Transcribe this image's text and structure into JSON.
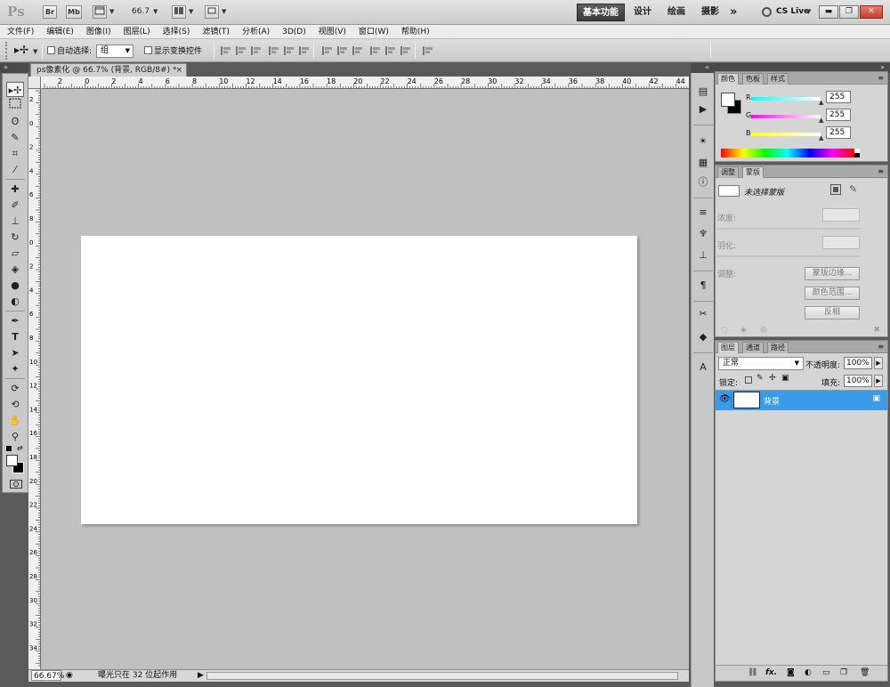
{
  "appbar": {
    "logo": "Ps",
    "br_label": "Br",
    "mb_label": "Mb",
    "zoom": "66.7",
    "workspaces": [
      "基本功能",
      "设计",
      "绘画",
      "摄影"
    ],
    "more": "»",
    "cslive": "CS Live"
  },
  "menu": [
    "文件(F)",
    "编辑(E)",
    "图像(I)",
    "图层(L)",
    "选择(S)",
    "滤镜(T)",
    "分析(A)",
    "3D(D)",
    "视图(V)",
    "窗口(W)",
    "帮助(H)"
  ],
  "options": {
    "auto_select_label": "自动选择:",
    "auto_select_value": "组",
    "show_transform_label": "显示变换控件"
  },
  "document": {
    "tab_title": "ps像素化 @ 66.7% (背景, RGB/8#) *",
    "close_glyph": "×",
    "ruler_top_labels": [
      "2",
      "0",
      "2",
      "4",
      "6",
      "8",
      "10",
      "12",
      "14",
      "16",
      "18",
      "20",
      "22",
      "24",
      "26",
      "28",
      "30",
      "32",
      "34",
      "36",
      "38",
      "40",
      "42",
      "44"
    ],
    "ruler_left_labels": [
      "2",
      "0",
      "2",
      "4",
      "6",
      "8",
      "0",
      "2",
      "4",
      "6",
      "8",
      "10",
      "12",
      "14",
      "16",
      "18",
      "20",
      "22",
      "24",
      "26",
      "28",
      "30",
      "32",
      "34"
    ]
  },
  "status": {
    "zoom": "66.67%",
    "text": "曝光只在 32 位起作用"
  },
  "color_panel": {
    "tabs": [
      "颜色",
      "色板",
      "样式"
    ],
    "r_label": "R",
    "g_label": "G",
    "b_label": "B",
    "r_value": "255",
    "g_value": "255",
    "b_value": "255"
  },
  "masks_panel": {
    "tabs": [
      "调整",
      "蒙版"
    ],
    "no_mask": "未选择蒙版",
    "density_label": "浓度:",
    "feather_label": "羽化:",
    "refine_label": "调整:",
    "mask_edge_btn": "蒙版边缘...",
    "color_range_btn": "颜色范围...",
    "invert_btn": "反相"
  },
  "layers_panel": {
    "tabs": [
      "图层",
      "通道",
      "路径"
    ],
    "blend_mode": "正常",
    "opacity_label": "不透明度:",
    "opacity_value": "100%",
    "lock_label": "锁定:",
    "fill_label": "填充:",
    "fill_value": "100%",
    "layer_name": "背景",
    "footer_fx": "fx."
  },
  "colors": {
    "selected_layer": "#3a9ce8",
    "app_bg": "#5a5a5a",
    "canvas_bg": "#c0c0c0"
  }
}
